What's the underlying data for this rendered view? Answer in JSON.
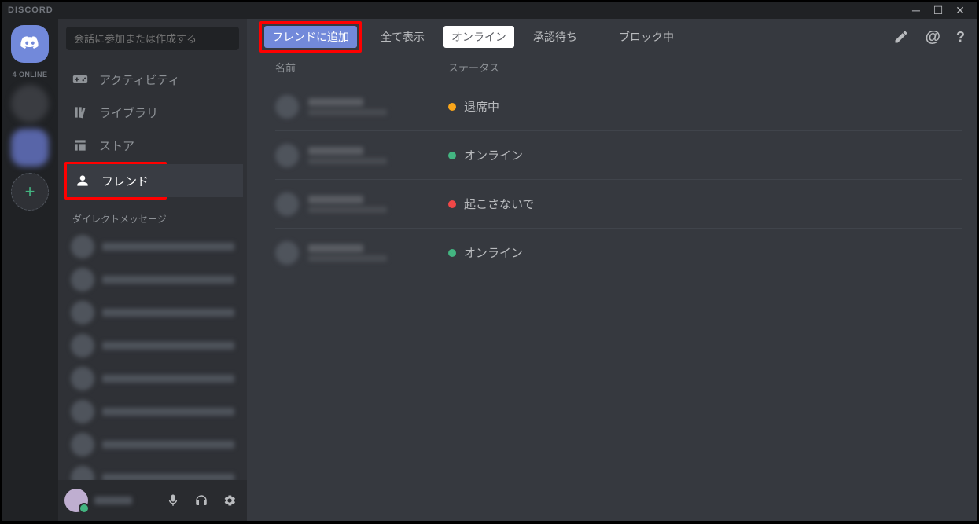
{
  "titlebar": {
    "brand": "DISCORD"
  },
  "guilds": {
    "online_label": "4 ONLINE"
  },
  "search": {
    "placeholder": "会話に参加または作成する"
  },
  "nav": {
    "activity": "アクティビティ",
    "library": "ライブラリ",
    "store": "ストア",
    "friends": "フレンド"
  },
  "dm_header": "ダイレクトメッセージ",
  "toolbar": {
    "add_friend": "フレンドに追加",
    "all": "全て表示",
    "online": "オンライン",
    "pending": "承認待ち",
    "blocked": "ブロック中"
  },
  "columns": {
    "name": "名前",
    "status": "ステータス"
  },
  "friends": [
    {
      "status_class": "away",
      "status_text": "退席中"
    },
    {
      "status_class": "online",
      "status_text": "オンライン"
    },
    {
      "status_class": "dnd",
      "status_text": "起こさないで"
    },
    {
      "status_class": "online",
      "status_text": "オンライン"
    }
  ]
}
